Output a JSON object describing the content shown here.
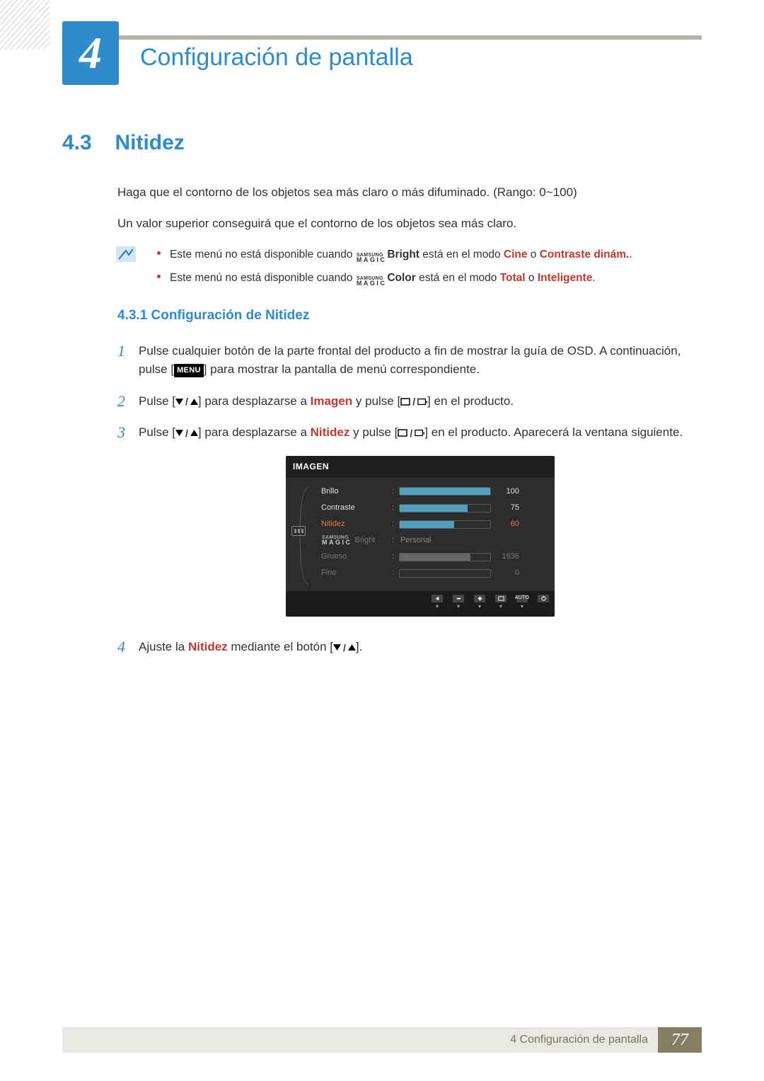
{
  "header": {
    "chapter_number": "4",
    "chapter_title": "Configuración de pantalla"
  },
  "section": {
    "number": "4.3",
    "title": "Nitidez",
    "intro1": "Haga que el contorno de los objetos sea más claro o más difuminado. (Rango: 0~100)",
    "intro2": "Un valor superior conseguirá que el contorno de los objetos sea más claro.",
    "magic": {
      "top": "SAMSUNG",
      "bottom": "MAGIC"
    },
    "note1": {
      "pre": "Este menú no está disponible cuando ",
      "suffix": "Bright",
      "mid": " está en el modo ",
      "k1": "Cine",
      "or": " o ",
      "k2": "Contraste dinám.",
      "end": "."
    },
    "note2": {
      "pre": "Este menú no está disponible cuando ",
      "suffix": "Color",
      "mid": " está en el modo ",
      "k1": "Total",
      "or": " o ",
      "k2": "Inteligente",
      "end": "."
    }
  },
  "subsection": {
    "number": "4.3.1",
    "sep": "  ",
    "title": "Configuración de Nitidez",
    "menu_label": "MENU",
    "step1a": "Pulse cualquier botón de la parte frontal del producto a fin de mostrar la guía de OSD. A continuación, pulse [",
    "step1b": "] para mostrar la pantalla de menú correspondiente.",
    "step2a": "Pulse [",
    "step2b": "] para desplazarse a ",
    "step2_keyword": "Imagen",
    "step2c": " y pulse [",
    "step2d": "] en el producto.",
    "step3a": "Pulse [",
    "step3b": "] para desplazarse a ",
    "step3_keyword": "Nitidez",
    "step3c": " y pulse [",
    "step3d": "] en el producto. Aparecerá la ventana siguiente.",
    "step4a": "Ajuste la ",
    "step4_keyword": "Nitidez",
    "step4b": " mediante el botón [",
    "step4c": "]."
  },
  "osd": {
    "title": "IMAGEN",
    "rows": [
      {
        "label": "Brillo",
        "value": "100",
        "pct": 100,
        "type": "bar"
      },
      {
        "label": "Contraste",
        "value": "75",
        "pct": 75,
        "type": "bar"
      },
      {
        "label": "Nitidez",
        "value": "60",
        "pct": 60,
        "type": "bar",
        "active": true
      },
      {
        "label_magic": true,
        "suffix": " Bright",
        "text": "Personal",
        "type": "text",
        "dim": true
      },
      {
        "label": "Grueso",
        "value": "1936",
        "pct": 78,
        "type": "bar",
        "dimbar": true,
        "dim": true
      },
      {
        "label": "Fino",
        "value": "0",
        "pct": 0,
        "type": "bar",
        "dimbar": true,
        "dim": true
      }
    ],
    "footer_auto": "AUTO"
  },
  "footer": {
    "text": "4 Configuración de pantalla",
    "page": "77"
  }
}
